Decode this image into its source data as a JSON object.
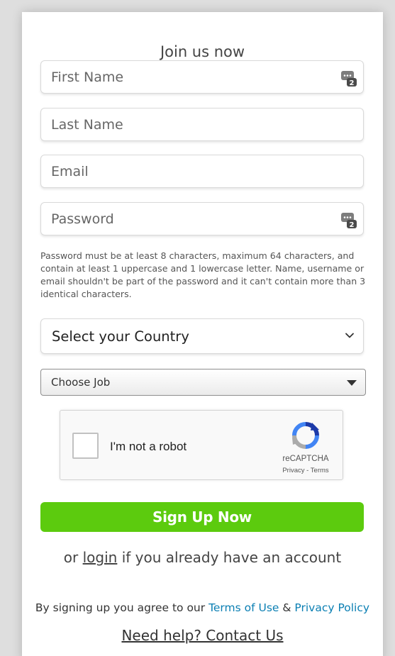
{
  "form": {
    "title": "Join us now",
    "first_name_placeholder": "First Name",
    "last_name_placeholder": "Last Name",
    "email_placeholder": "Email",
    "password_placeholder": "Password",
    "password_hint": "Password must be at least 8 characters, maximum 64 characters, and contain at least 1 uppercase and 1 lowercase letter. Name, username or email shouldn't be part of the password and it can't contain more than 3 identical characters.",
    "country_select": "Select your Country",
    "job_select": "Choose Job",
    "signup_button": "Sign Up Now"
  },
  "captcha": {
    "label": "I'm not a robot",
    "brand": "reCAPTCHA",
    "privacy": "Privacy",
    "separator": " - ",
    "terms": "Terms"
  },
  "footer": {
    "login_prefix": "or ",
    "login_link": "login",
    "login_suffix": " if you already have an account",
    "agree_prefix": "By signing up you agree to our ",
    "terms_link": "Terms of Use",
    "amp": " & ",
    "privacy_link": "Privacy Policy",
    "help_link": "Need help? Contact Us"
  },
  "icons": {
    "password_manager": "password-manager-icon",
    "dropdown": "chevron-down-icon",
    "job_dropdown": "caret-down-icon",
    "recaptcha_logo": "recaptcha-logo-icon"
  },
  "colors": {
    "signup_button": "#5ccb0e",
    "link": "#0b7fb3",
    "background": "#dedede"
  }
}
